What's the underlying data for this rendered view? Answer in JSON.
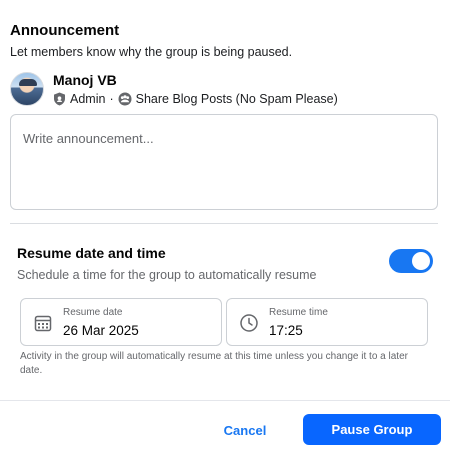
{
  "announcement": {
    "title": "Announcement",
    "subtitle": "Let members know why the group is being paused."
  },
  "user": {
    "name": "Manoj VB",
    "role": "Admin",
    "separator": "·",
    "group_name": "Share Blog Posts (No Spam Please)",
    "role_icon": "shield-icon",
    "group_icon": "group-icon"
  },
  "announcement_input": {
    "placeholder": "Write announcement...",
    "value": ""
  },
  "resume": {
    "title": "Resume date and time",
    "subtitle": "Schedule a time for the group to automatically resume",
    "toggle_on": true,
    "date_label": "Resume date",
    "date_value": "26 Mar 2025",
    "date_icon": "calendar-icon",
    "time_label": "Resume time",
    "time_value": "17:25",
    "time_icon": "clock-icon",
    "hint": "Activity in the group will automatically resume at this time unless you change it to a later date."
  },
  "footer": {
    "cancel_label": "Cancel",
    "pause_label": "Pause Group"
  },
  "colors": {
    "accent": "#1877f2",
    "primary_button": "#0866ff",
    "border": "#ccd0d5",
    "muted_text": "#65676b"
  }
}
